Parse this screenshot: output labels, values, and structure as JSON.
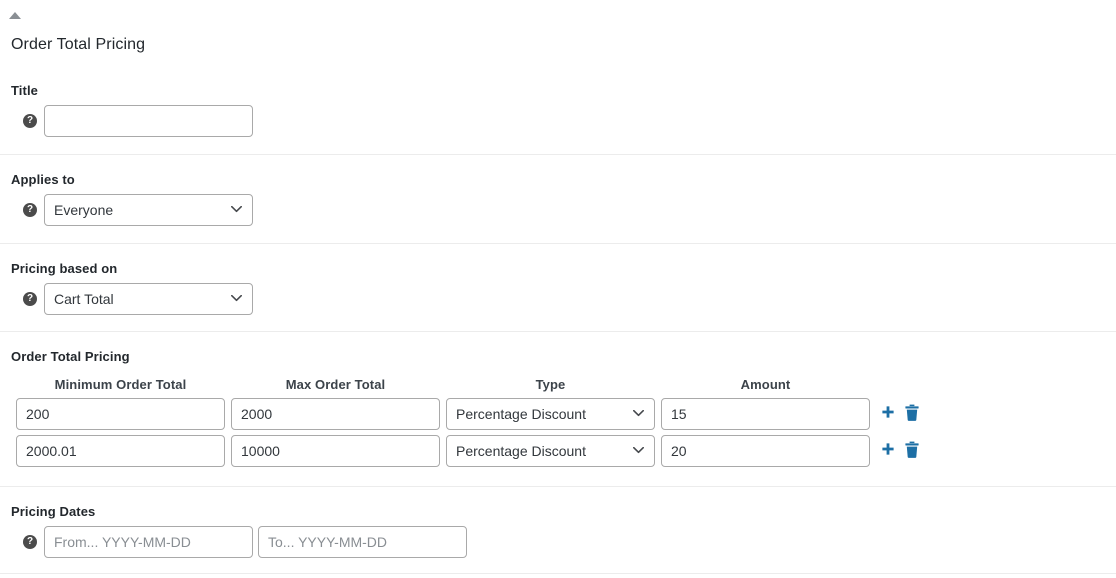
{
  "panel": {
    "collapse_icon": "triangle-up-icon",
    "title": "Order Total Pricing"
  },
  "fields": {
    "title": {
      "label": "Title",
      "help_icon": "help-icon",
      "help_glyph": "?",
      "value": "",
      "placeholder": ""
    },
    "applies_to": {
      "label": "Applies to",
      "help_icon": "help-icon",
      "help_glyph": "?",
      "selected": "Everyone",
      "chevron_icon": "chevron-down-icon"
    },
    "pricing_based_on": {
      "label": "Pricing based on",
      "help_icon": "help-icon",
      "help_glyph": "?",
      "selected": "Cart Total",
      "chevron_icon": "chevron-down-icon"
    },
    "pricing_dates": {
      "label": "Pricing Dates",
      "help_icon": "help-icon",
      "help_glyph": "?",
      "from_value": "",
      "from_placeholder": "From... YYYY-MM-DD",
      "to_value": "",
      "to_placeholder": "To... YYYY-MM-DD"
    }
  },
  "pricing_table": {
    "section_label": "Order Total Pricing",
    "columns": [
      "Minimum Order Total",
      "Max Order Total",
      "Type",
      "Amount"
    ],
    "rows": [
      {
        "minimum_order_total": "200",
        "max_order_total": "2000",
        "type": "Percentage Discount",
        "amount": "15",
        "add_icon": "plus-icon",
        "delete_icon": "trash-icon"
      },
      {
        "minimum_order_total": "2000.01",
        "max_order_total": "10000",
        "type": "Percentage Discount",
        "amount": "20",
        "add_icon": "plus-icon",
        "delete_icon": "trash-icon"
      }
    ]
  },
  "colors": {
    "action_blue": "#1d6fa5",
    "divider": "#ececec",
    "border": "#a9a9a9",
    "text": "#23282d"
  }
}
